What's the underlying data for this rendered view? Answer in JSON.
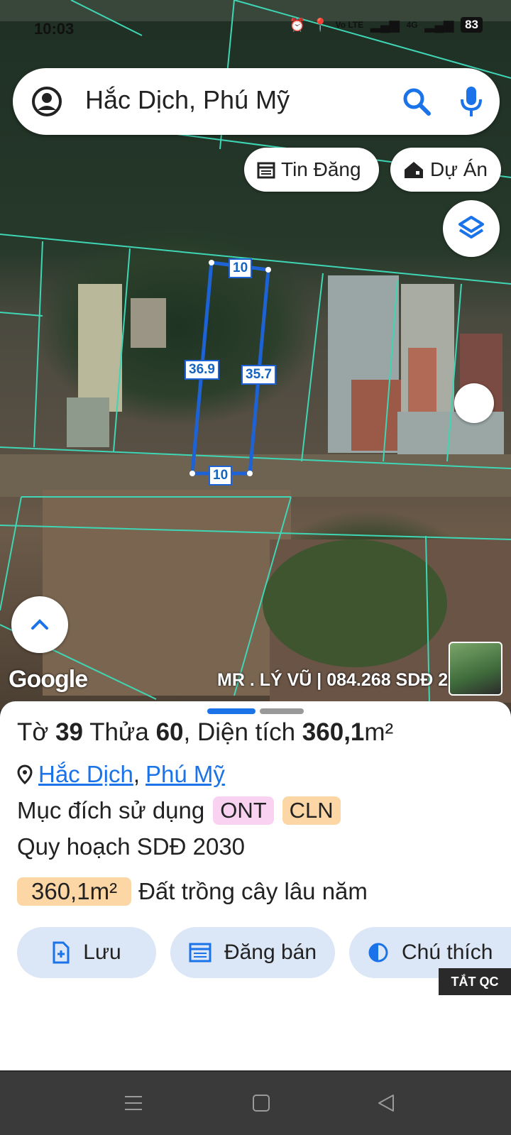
{
  "status_bar": {
    "time": "10:03",
    "net_label": "Vo LTE",
    "net_type": "4G",
    "battery": "83"
  },
  "search": {
    "query": "Hắc Dịch, Phú Mỹ"
  },
  "chips": {
    "listings_label": "Tin Đăng",
    "projects_label": "Dự Án"
  },
  "plot_dimensions": {
    "top": "10",
    "left": "36.9",
    "right": "35.7",
    "bottom": "10"
  },
  "map_attribution": {
    "google": "Google",
    "watermark": "MR . LÝ VŨ | 084.268 SDĐ 2030"
  },
  "parcel": {
    "title_prefix": "Tờ ",
    "sheet_no": "39",
    "title_mid": " Thửa ",
    "parcel_no": "60",
    "title_area_label": ", Diện tích ",
    "area": "360,1",
    "area_unit": "m²",
    "location_commune": "Hắc Dịch",
    "location_sep": ",",
    "location_town": "Phú Mỹ",
    "purpose_label": "Mục đích sử dụng",
    "purpose_tags": [
      "ONT",
      "CLN"
    ],
    "plan_label": "Quy hoạch SDĐ 2030",
    "plan_area": "360,1m²",
    "plan_desc": "Đất trồng cây lâu năm"
  },
  "actions": {
    "save_label": "Lưu",
    "sell_label": "Đăng bán",
    "legend_label": "Chú thích"
  },
  "ad_toggle": "TẮT QC",
  "colors": {
    "accent": "#1a73e8",
    "plot_outline": "#1e63d6",
    "parcel_lines": "#3fd6b5",
    "ont_tag": "#f9d2f2",
    "cln_tag": "#fdd6a6",
    "button_bg": "#dbe6f6"
  }
}
